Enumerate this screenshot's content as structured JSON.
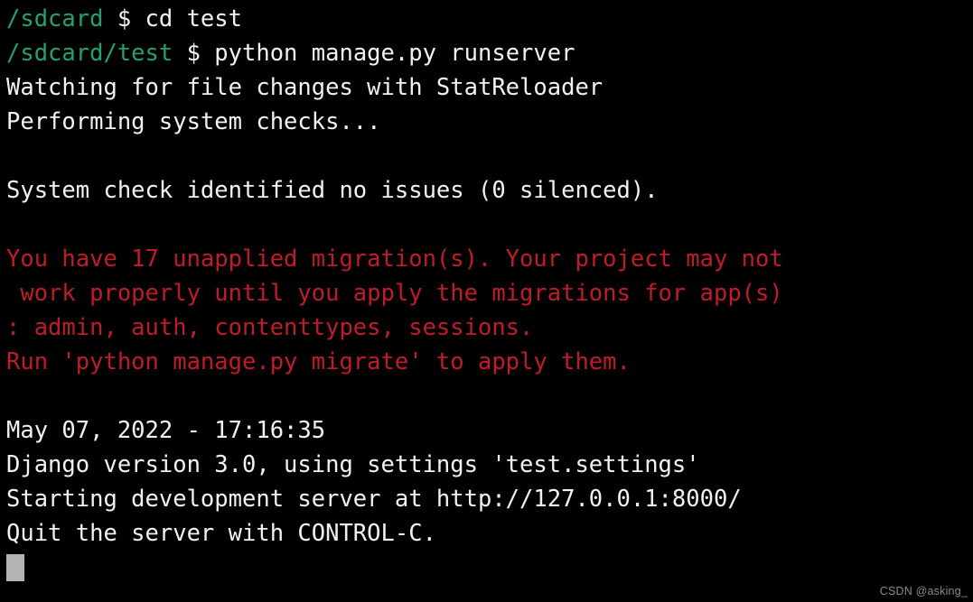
{
  "terminal": {
    "app": "termux-terminal",
    "background_color": "#000000",
    "foreground_color": "#f2f2f2",
    "prompt_color": "#26a269",
    "error_color": "#c01c28",
    "cursor_color": "#b3b3b3",
    "columns": 55,
    "rows": 17,
    "lines": [
      {
        "type": "prompt",
        "segments": [
          {
            "color": "green",
            "text": "/sdcard"
          },
          {
            "color": "white",
            "text": " $ cd test"
          }
        ]
      },
      {
        "type": "prompt",
        "segments": [
          {
            "color": "green",
            "text": "/sdcard/test"
          },
          {
            "color": "white",
            "text": " $ python manage.py runserver"
          }
        ]
      },
      {
        "type": "output",
        "segments": [
          {
            "color": "white",
            "text": "Watching for file changes with StatReloader"
          }
        ]
      },
      {
        "type": "output",
        "segments": [
          {
            "color": "white",
            "text": "Performing system checks..."
          }
        ]
      },
      {
        "type": "blank",
        "segments": []
      },
      {
        "type": "output",
        "segments": [
          {
            "color": "white",
            "text": "System check identified no issues (0 silenced)."
          }
        ]
      },
      {
        "type": "blank",
        "segments": []
      },
      {
        "type": "error",
        "segments": [
          {
            "color": "red",
            "text": "You have 17 unapplied migration(s). Your project may not"
          }
        ]
      },
      {
        "type": "error",
        "segments": [
          {
            "color": "red",
            "text": " work properly until you apply the migrations for app(s)"
          }
        ]
      },
      {
        "type": "error",
        "segments": [
          {
            "color": "red",
            "text": ": admin, auth, contenttypes, sessions."
          }
        ]
      },
      {
        "type": "error",
        "segments": [
          {
            "color": "red",
            "text": "Run 'python manage.py migrate' to apply them."
          }
        ]
      },
      {
        "type": "blank",
        "segments": []
      },
      {
        "type": "output",
        "segments": [
          {
            "color": "white",
            "text": "May 07, 2022 - 17:16:35"
          }
        ]
      },
      {
        "type": "output",
        "segments": [
          {
            "color": "white",
            "text": "Django version 3.0, using settings 'test.settings'"
          }
        ]
      },
      {
        "type": "output",
        "segments": [
          {
            "color": "white",
            "text": "Starting development server at http://127.0.0.1:8000/"
          }
        ]
      },
      {
        "type": "output",
        "segments": [
          {
            "color": "white",
            "text": "Quit the server with CONTROL-C."
          }
        ]
      }
    ]
  },
  "watermark": {
    "text": "CSDN @asking_"
  }
}
